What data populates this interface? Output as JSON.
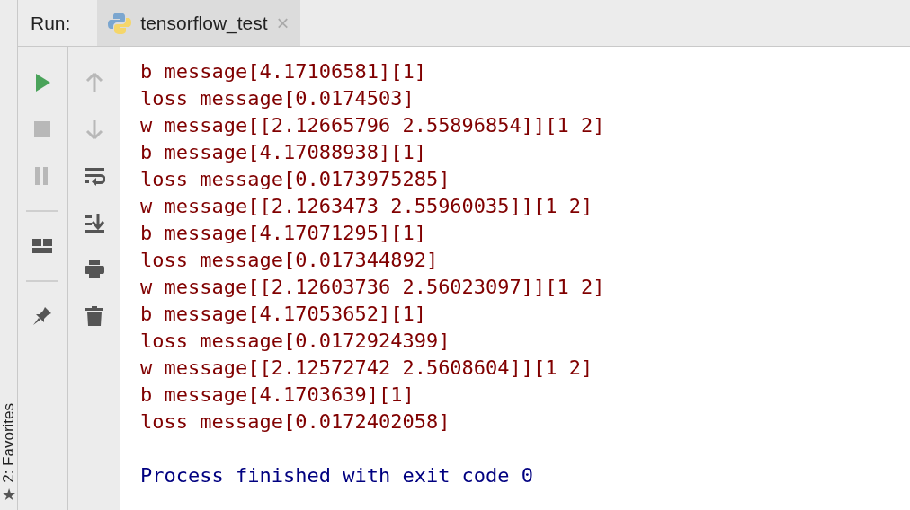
{
  "side_bar": {
    "label": "2: Favorites",
    "icon": "★"
  },
  "run_bar": {
    "label": "Run:",
    "tabs": [
      {
        "label": "tensorflow_test",
        "selected": true,
        "close": "×"
      }
    ]
  },
  "toolbar_left": [
    {
      "kind": "run",
      "disabled": false
    },
    {
      "kind": "stop",
      "disabled": true
    },
    {
      "kind": "pause",
      "disabled": true
    },
    {
      "kind": "separator"
    },
    {
      "kind": "layout",
      "disabled": false
    },
    {
      "kind": "separator"
    },
    {
      "kind": "pin",
      "disabled": false
    }
  ],
  "toolbar_right": [
    {
      "kind": "up",
      "disabled": true
    },
    {
      "kind": "down",
      "disabled": true
    },
    {
      "kind": "wrap",
      "disabled": false
    },
    {
      "kind": "scroll-end",
      "disabled": false
    },
    {
      "kind": "print",
      "disabled": false
    },
    {
      "kind": "trash",
      "disabled": false
    }
  ],
  "console": [
    {
      "kind": "output",
      "text": "b message[4.17106581][1]"
    },
    {
      "kind": "output",
      "text": "loss message[0.0174503]"
    },
    {
      "kind": "output",
      "text": "w message[[2.12665796 2.55896854]][1 2]"
    },
    {
      "kind": "output",
      "text": "b message[4.17088938][1]"
    },
    {
      "kind": "output",
      "text": "loss message[0.0173975285]"
    },
    {
      "kind": "output",
      "text": "w message[[2.1263473 2.55960035]][1 2]"
    },
    {
      "kind": "output",
      "text": "b message[4.17071295][1]"
    },
    {
      "kind": "output",
      "text": "loss message[0.017344892]"
    },
    {
      "kind": "output",
      "text": "w message[[2.12603736 2.56023097]][1 2]"
    },
    {
      "kind": "output",
      "text": "b message[4.17053652][1]"
    },
    {
      "kind": "output",
      "text": "loss message[0.0172924399]"
    },
    {
      "kind": "output",
      "text": "w message[[2.12572742 2.5608604]][1 2]"
    },
    {
      "kind": "output",
      "text": "b message[4.1703639][1]"
    },
    {
      "kind": "output",
      "text": "loss message[0.0172402058]"
    },
    {
      "kind": "exit",
      "text": "Process finished with exit code 0"
    }
  ]
}
